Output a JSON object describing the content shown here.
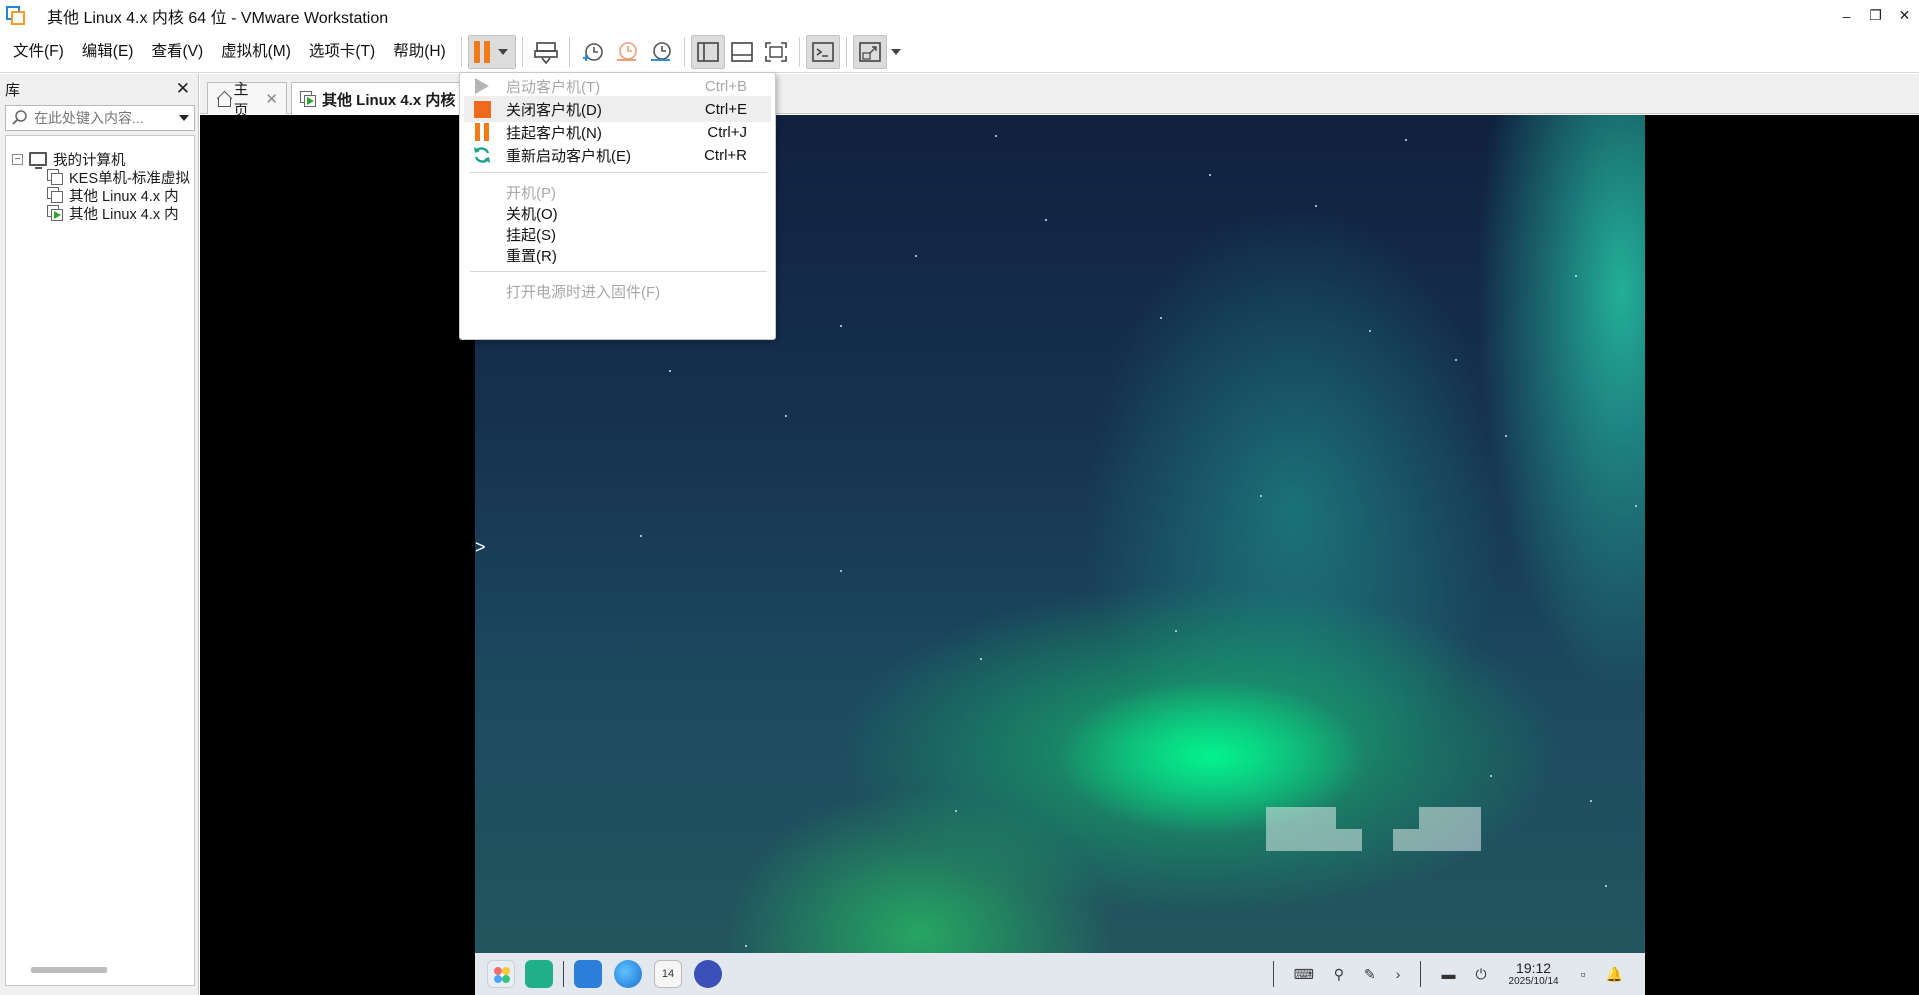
{
  "window": {
    "title": "其他 Linux 4.x 内核 64 位 - VMware Workstation",
    "controls": [
      "–",
      "❐",
      "✕"
    ]
  },
  "menubar": {
    "items": [
      "文件(F)",
      "编辑(E)",
      "查看(V)",
      "虚拟机(M)",
      "选项卡(T)",
      "帮助(H)"
    ]
  },
  "library": {
    "title": "库",
    "close": "✕",
    "search_placeholder": "在此处键入内容...",
    "tree": {
      "root": "我的计算机",
      "expander": "−",
      "items": [
        "KES单机-标准虚拟",
        "其他 Linux 4.x 内",
        "其他 Linux 4.x 内"
      ]
    }
  },
  "tabs": [
    {
      "label": "主页",
      "close": "✕"
    },
    {
      "label": "其他 Linux 4.x 内核"
    }
  ],
  "power_menu": {
    "items": [
      {
        "label": "启动客户机(T)",
        "shortcut": "Ctrl+B",
        "icon": "play-icon",
        "disabled": true
      },
      {
        "label": "关闭客户机(D)",
        "shortcut": "Ctrl+E",
        "icon": "stop-icon",
        "disabled": false
      },
      {
        "label": "挂起客户机(N)",
        "shortcut": "Ctrl+J",
        "icon": "pause-icon",
        "disabled": false
      },
      {
        "label": "重新启动客户机(E)",
        "shortcut": "Ctrl+R",
        "icon": "restart-icon",
        "disabled": false
      },
      {
        "label": "开机(P)",
        "disabled": true
      },
      {
        "label": "关机(O)",
        "disabled": false
      },
      {
        "label": "挂起(S)",
        "disabled": false
      },
      {
        "label": "重置(R)",
        "disabled": false
      },
      {
        "label": "打开电源时进入固件(F)",
        "disabled": true
      }
    ]
  },
  "guest": {
    "taskbar": {
      "calendar_day": "14",
      "time": "19:12",
      "date": "2025/10/14"
    }
  },
  "colors": {
    "accent_orange": "#f07b18",
    "stop_red": "#f06a1e",
    "restart_green": "#1aa38a"
  }
}
